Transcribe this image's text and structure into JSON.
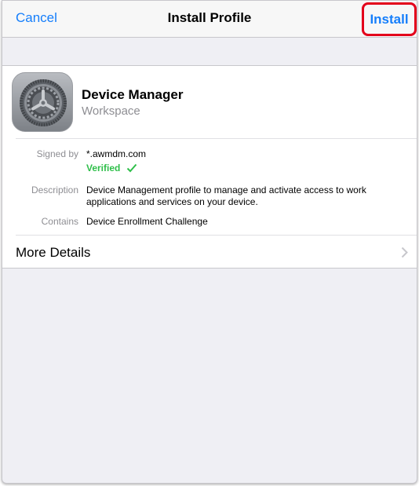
{
  "navbar": {
    "cancel_label": "Cancel",
    "title": "Install Profile",
    "install_label": "Install",
    "highlight_color": "#e3001b",
    "tint_color": "#157efb"
  },
  "profile": {
    "icon": "settings-gear-icon",
    "name": "Device Manager",
    "organization": "Workspace"
  },
  "details": {
    "signed_by_label": "Signed by",
    "signed_by_value": "*.awmdm.com",
    "verified_label": "Verified",
    "verified_color": "#2fbf4a",
    "description_label": "Description",
    "description_line1": "Device Management profile to manage and activate access to work",
    "description_line2": "applications and services on your device.",
    "contains_label": "Contains",
    "contains_value": "Device Enrollment Challenge"
  },
  "more_details": {
    "label": "More Details",
    "icon": "chevron-right-icon"
  }
}
